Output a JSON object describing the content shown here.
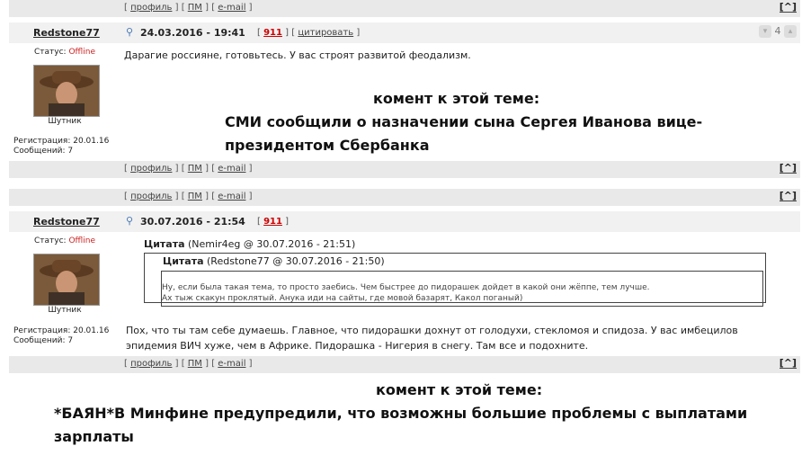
{
  "links": {
    "profile": "профиль",
    "pm": "ПМ",
    "email": "e-mail",
    "top": "[^]"
  },
  "post1": {
    "author": "Redstone77",
    "date": "24.03.2016 - 19:41",
    "number": "911",
    "cite": "цитировать",
    "status_label": "Статус:",
    "status": "Offline",
    "rank": "Шутник",
    "reg": "Регистрация: 20.01.16",
    "msgs": "Сообщений: 7",
    "text": "Дарагие россияне, готовьтесь. У вас строят развитой феодализм.",
    "votes": "4"
  },
  "overlay1": {
    "label": "комент к этой теме:",
    "line1": "СМИ сообщили о назначении сына Сергея Иванова вице-",
    "line2": "президентом Сбербанка"
  },
  "post2": {
    "author": "Redstone77",
    "date": "30.07.2016 - 21:54",
    "number": "911",
    "status_label": "Статус:",
    "status": "Offline",
    "rank": "Шутник",
    "reg": "Регистрация: 20.01.16",
    "msgs": "Сообщений: 7",
    "quote_outer_label": "Цитата",
    "quote_outer_src": "(Nemir4eg @ 30.07.2016 - 21:51)",
    "quote_inner_label": "Цитата",
    "quote_inner_src": "(Redstone77 @ 30.07.2016 - 21:50)",
    "quote_line1": "Ну, если была такая тема, то просто заебись. Чем быстрее до пидорашек дойдет в какой они жёппе, тем лучше.",
    "quote_line2": "Ах тыж скакун проклятый. Анука иди на сайты, где мовой базарят, Какол поганый)",
    "text_line1": "Пох, что ты там себе думаешь. Главное, что пидорашки дохнут от голодухи, стекломоя и спидоза. У вас имбецилов",
    "text_line2": "эпидемия ВИЧ хуже, чем в Африке. Пидорашка - Нигерия в снегу. Там все и подохните."
  },
  "overlay2": {
    "label": "комент к этой теме:",
    "line1": "*БАЯН*В Минфине предупредили, что возможны большие проблемы с выплатами",
    "line2": "зарплаты"
  }
}
